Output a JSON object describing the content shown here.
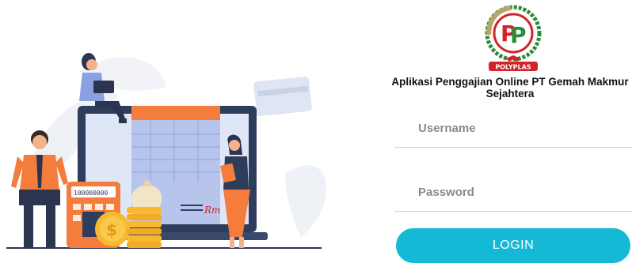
{
  "app": {
    "title": "Aplikasi Penggajian Online PT Gemah Makmur Sejahtera",
    "logo_text": "POLYPLAS"
  },
  "login": {
    "username_placeholder": "Username",
    "password_placeholder": "Password",
    "button_label": "LOGIN"
  },
  "illustration": {
    "calculator_display": "100000000",
    "signature": "Rm"
  },
  "colors": {
    "accent": "#14b9d6",
    "laptop": "#2f3d5c",
    "orange": "#f47c3c",
    "gold": "#f7b92f",
    "logo_red": "#d2232a",
    "logo_green": "#2e8b3a"
  }
}
